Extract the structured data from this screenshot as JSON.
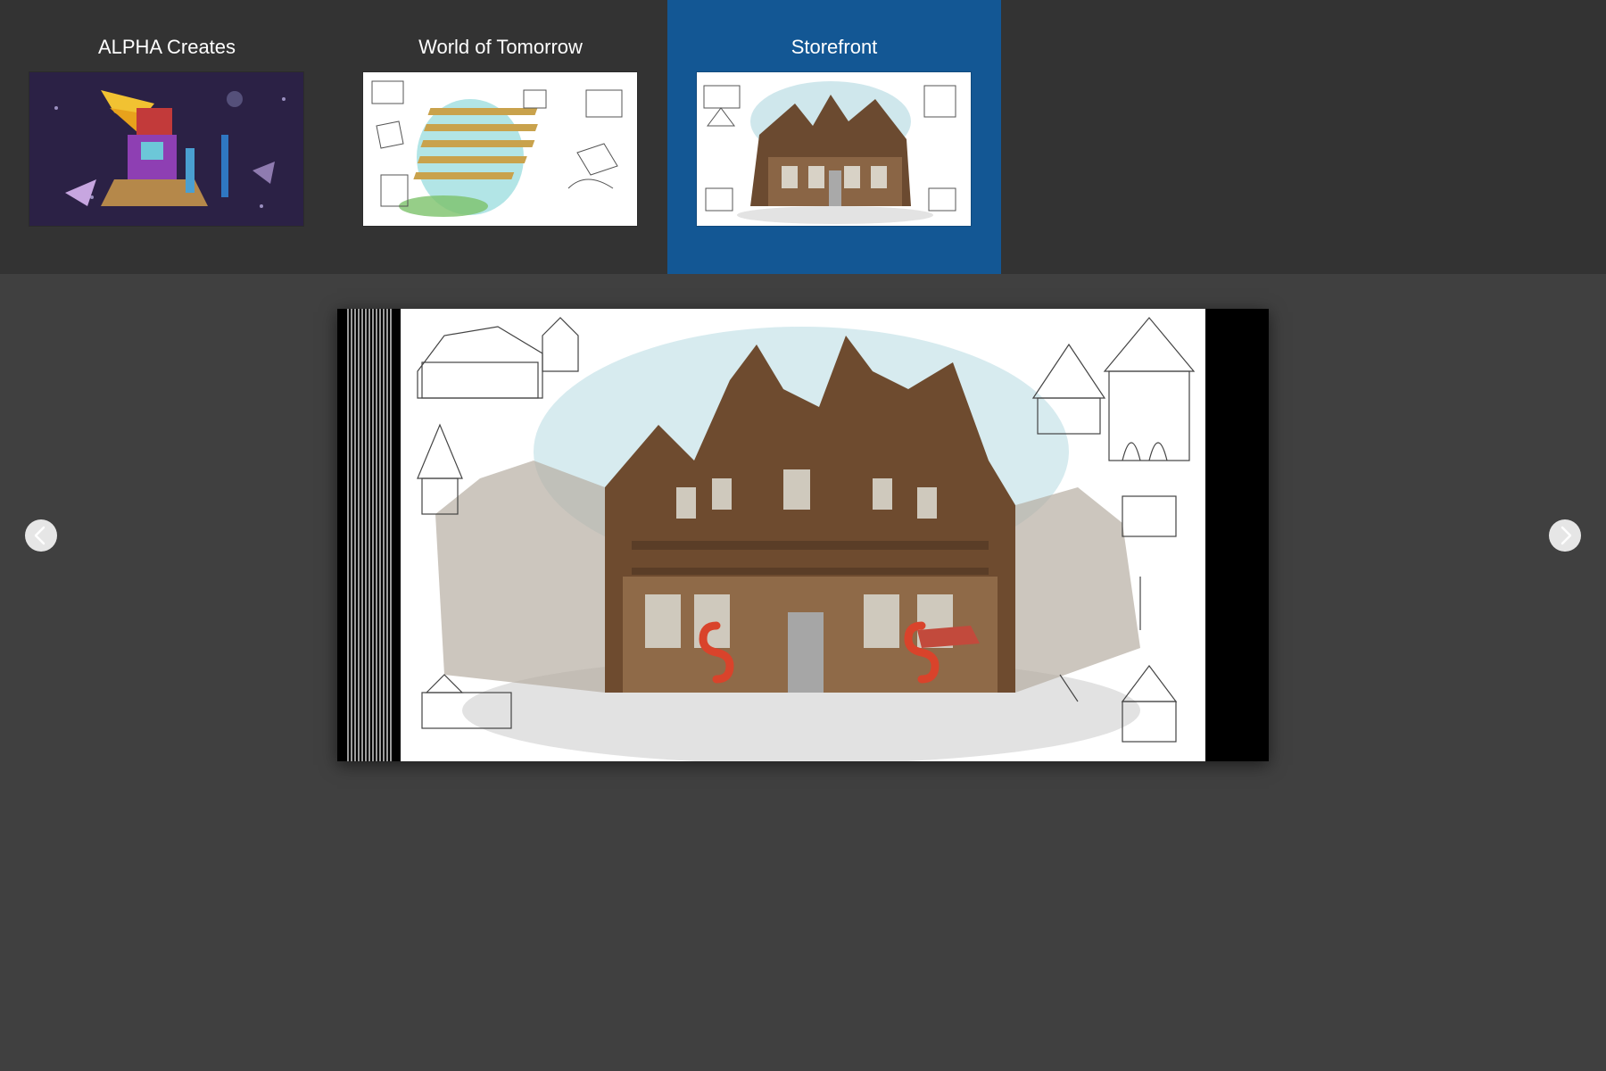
{
  "gallery": {
    "items": [
      {
        "title": "ALPHA Creates",
        "selected": false,
        "thumbnail": "alpha-creates-artwork"
      },
      {
        "title": "World of Tomorrow",
        "selected": false,
        "thumbnail": "world-of-tomorrow-artwork"
      },
      {
        "title": "Storefront",
        "selected": true,
        "thumbnail": "storefront-artwork"
      }
    ]
  },
  "viewer": {
    "image": "storefront-artwork",
    "prev_icon": "chevron-left-icon",
    "next_icon": "chevron-right-icon"
  },
  "colors": {
    "top_bar": "#333333",
    "selected_tile": "#135794",
    "main_background": "#404040",
    "nav_button": "#e6e6e6"
  }
}
